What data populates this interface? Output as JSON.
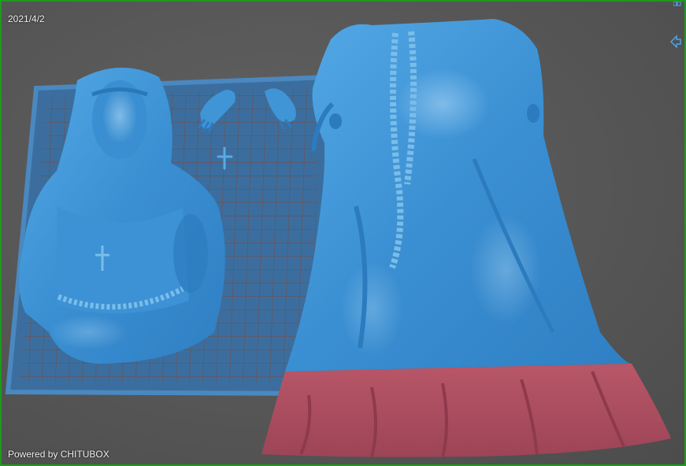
{
  "viewport": {
    "date": "2021/4/2",
    "branding": "Powered by CHITUBOX"
  },
  "icons": {
    "view-arrow": "arrow-left-icon",
    "origin": "crosshair-icon"
  },
  "colors": {
    "background": "#5a5a5a",
    "build_plate": "#4a88c0",
    "model": "#3f95d6",
    "model_highlight": "#9fd3f5",
    "selection_overhang": "#c0586a",
    "frame": "#1e9a1e"
  }
}
